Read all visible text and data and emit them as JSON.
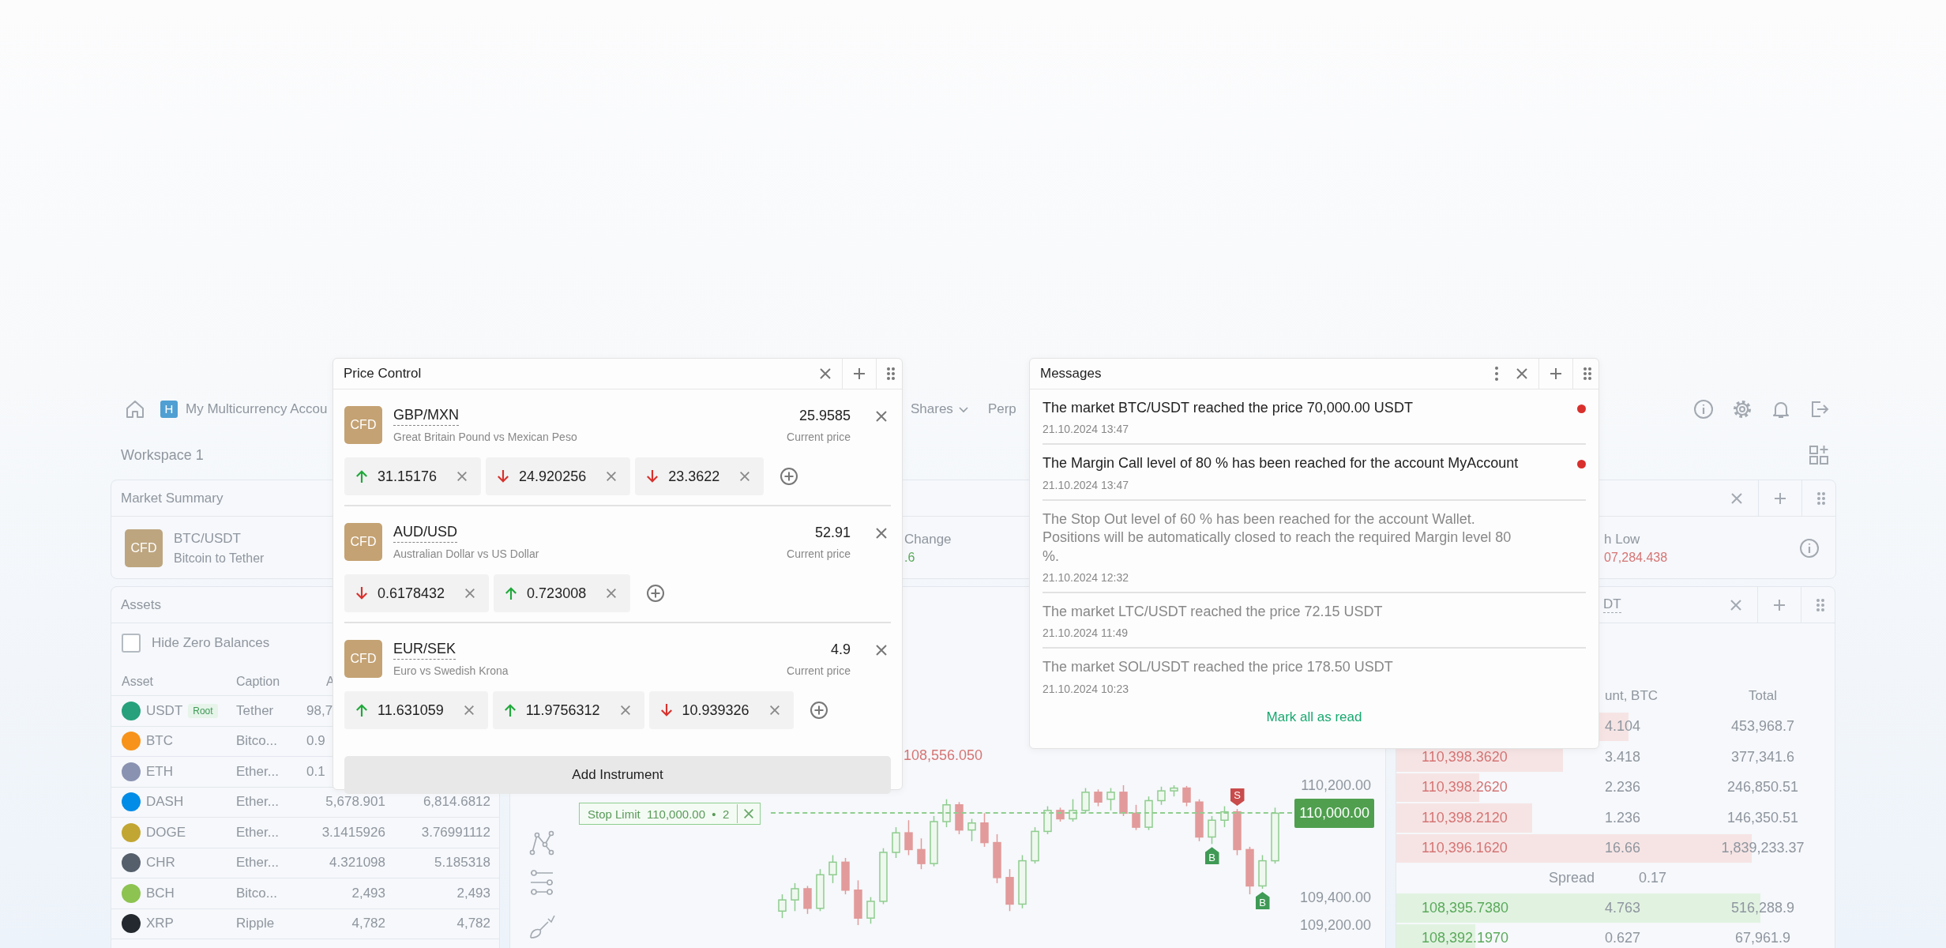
{
  "top_bar": {
    "account_badge": "H",
    "account_name": "My Multicurrency Accou",
    "nav": [
      {
        "label": "Shares",
        "dropdown": true
      },
      {
        "label": "Perp",
        "dropdown": false
      }
    ]
  },
  "workspace": {
    "title": "Workspace 1"
  },
  "market_summary": {
    "title": "Market Summary",
    "badge": "CFD",
    "symbol": "BTC/USDT",
    "description": "Bitcoin to Tether",
    "stats": [
      {
        "label": "Change",
        "value": ".6",
        "kind": "gain"
      },
      {
        "label": "h Low",
        "value": "07,284.438",
        "kind": "loss"
      }
    ]
  },
  "assets": {
    "title": "Assets",
    "hide_zero": {
      "label": "Hide Zero Balances",
      "checked": false
    },
    "columns": [
      "Asset",
      "Caption",
      "A"
    ],
    "rows": [
      {
        "asset": "USDT",
        "tag": "Root",
        "caption": "Tether",
        "column_3": "98,7",
        "color": "#26a17b"
      },
      {
        "asset": "BTC",
        "caption": "Bitco...",
        "column_3": "0.9",
        "color": "#f7931a"
      },
      {
        "asset": "ETH",
        "caption": "Ether...",
        "column_3": "0.1",
        "color": "#8a92b2"
      },
      {
        "asset": "DASH",
        "caption": "Ether...",
        "column_3": "5,678.901",
        "column_4": "6,814.6812",
        "color": "#008ce7"
      },
      {
        "asset": "DOGE",
        "caption": "Ether...",
        "column_3": "3.1415926",
        "column_4": "3.76991112",
        "color": "#c2a633"
      },
      {
        "asset": "CHR",
        "caption": "Ether...",
        "column_3": "4.321098",
        "column_4": "5.185318",
        "color": "#555f6b"
      },
      {
        "asset": "BCH",
        "caption": "Bitco...",
        "column_3": "2,493",
        "column_4": "2,493",
        "color": "#8dc351"
      },
      {
        "asset": "XRP",
        "caption": "Ripple",
        "column_3": "4,782",
        "column_4": "4,782",
        "color": "#23292f"
      }
    ]
  },
  "chart": {
    "last_price": "108,556.050",
    "current_price": "110,000.00",
    "order": {
      "label": "Stop Limit",
      "price": "110,000.00",
      "separator": "•",
      "quantity": "2"
    },
    "markers": [
      {
        "kind": "buy",
        "label": "B"
      },
      {
        "kind": "sell",
        "label": "S"
      },
      {
        "kind": "buy",
        "label": "B"
      }
    ],
    "chart_data": {
      "type": "candlestick",
      "ylim": [
        109200,
        110200
      ],
      "ohlc": [
        [
          109300,
          109420,
          109250,
          109380
        ],
        [
          109380,
          109500,
          109300,
          109460
        ],
        [
          109460,
          109480,
          109280,
          109320
        ],
        [
          109320,
          109600,
          109300,
          109560
        ],
        [
          109560,
          109700,
          109500,
          109650
        ],
        [
          109650,
          109680,
          109420,
          109450
        ],
        [
          109450,
          109520,
          109200,
          109250
        ],
        [
          109250,
          109400,
          109210,
          109370
        ],
        [
          109370,
          109750,
          109350,
          109720
        ],
        [
          109720,
          109900,
          109680,
          109860
        ],
        [
          109860,
          109950,
          109700,
          109740
        ],
        [
          109740,
          109820,
          109600,
          109640
        ],
        [
          109640,
          109980,
          109620,
          109940
        ],
        [
          109940,
          110100,
          109900,
          110060
        ],
        [
          110060,
          110080,
          109850,
          109880
        ],
        [
          109880,
          109960,
          109800,
          109930
        ],
        [
          109930,
          110000,
          109760,
          109790
        ],
        [
          109790,
          109850,
          109500,
          109540
        ],
        [
          109540,
          109600,
          109300,
          109350
        ],
        [
          109350,
          109700,
          109320,
          109660
        ],
        [
          109660,
          109900,
          109640,
          109870
        ],
        [
          109870,
          110050,
          109850,
          110020
        ],
        [
          110020,
          110040,
          109940,
          109960
        ],
        [
          109960,
          110100,
          109940,
          110020
        ],
        [
          110020,
          110180,
          110000,
          110150
        ],
        [
          110150,
          110170,
          110050,
          110080
        ],
        [
          110100,
          110180,
          110020,
          110150
        ],
        [
          110150,
          110200,
          109980,
          110000
        ],
        [
          110000,
          110060,
          109880,
          109900
        ],
        [
          109900,
          110120,
          109880,
          110090
        ],
        [
          110090,
          110190,
          110060,
          110160
        ],
        [
          110160,
          110200,
          110120,
          110180
        ],
        [
          110180,
          110195,
          110050,
          110080
        ],
        [
          110080,
          110100,
          109800,
          109830
        ],
        [
          109830,
          109980,
          109780,
          109950
        ],
        [
          109950,
          110050,
          109900,
          110010
        ],
        [
          110010,
          110030,
          109700,
          109740
        ],
        [
          109740,
          109760,
          109420,
          109480
        ],
        [
          109480,
          109700,
          109460,
          109660
        ],
        [
          109660,
          110040,
          109640,
          110000
        ]
      ],
      "yticks": [
        {
          "value": 110200,
          "label": "110,200.00"
        },
        {
          "value": 109400,
          "label": "109,400.00"
        },
        {
          "value": 109200,
          "label": "109,200.00"
        }
      ]
    }
  },
  "order_book": {
    "title": "DT",
    "columns": [
      "unt, BTC",
      "Total"
    ],
    "asks": [
      {
        "amount": "4.104",
        "total": "453,968.7",
        "level": 0.53
      },
      {
        "price": "110,398.3620",
        "amount": "3.418",
        "total": "377,341.6",
        "level": 0.38
      },
      {
        "price": "110,398.2620",
        "amount": "2.236",
        "total": "246,850.51",
        "level": 0.19
      },
      {
        "price": "110,398.2120",
        "amount": "1.236",
        "total": "146,350.51",
        "level": 0.31
      },
      {
        "price": "110,396.1620",
        "amount": "16.66",
        "total": "1,839,233.37",
        "level": 0.81
      }
    ],
    "spread": {
      "label": "Spread",
      "value": "0.17"
    },
    "bids": [
      {
        "price": "108,395.7380",
        "amount": "4.763",
        "total": "516,288.9",
        "level": 0.83
      },
      {
        "price": "108,392.1970",
        "amount": "0.627",
        "total": "67,961.9",
        "level": 0.18
      }
    ]
  },
  "price_control": {
    "title": "Price Control",
    "instruments": [
      {
        "badge": "CFD",
        "symbol": "GBP/MXN",
        "description": "Great Britain Pound vs Mexican Peso",
        "price": "25.9585",
        "price_label": "Current price",
        "alerts": [
          {
            "kind": "up",
            "value": "31.15176"
          },
          {
            "kind": "down",
            "value": "24.920256"
          },
          {
            "kind": "down",
            "value": "23.3622"
          }
        ]
      },
      {
        "badge": "CFD",
        "symbol": "AUD/USD",
        "description": "Australian Dollar vs US Dollar",
        "price": "52.91",
        "price_label": "Current price",
        "alerts": [
          {
            "kind": "down",
            "value": "0.6178432"
          },
          {
            "kind": "up",
            "value": "0.723008"
          }
        ]
      },
      {
        "badge": "CFD",
        "symbol": "EUR/SEK",
        "description": "Euro vs Swedish Krona",
        "price": "4.9",
        "price_label": "Current price",
        "alerts": [
          {
            "kind": "up",
            "value": "11.631059"
          },
          {
            "kind": "up",
            "value": "11.9756312"
          },
          {
            "kind": "down",
            "value": "10.939326"
          }
        ]
      }
    ],
    "add_button": "Add Instrument"
  },
  "messages": {
    "title": "Messages",
    "items": [
      {
        "text": "The market BTC/USDT reached the price 70,000.00 USDT",
        "date": "21.10.2024 13:47",
        "unread": true
      },
      {
        "text": "The Margin Call level of 80 % has been reached for the account MyAccount",
        "date": "21.10.2024 13:47",
        "unread": true
      },
      {
        "text": "The Stop Out level of 60 % has been reached for the account Wallet.\nPositions will be automatically closed to reach the required Margin level 80 %.",
        "date": "21.10.2024 12:32",
        "unread": false
      },
      {
        "text": "The market LTC/USDT reached the price 72.15 USDT",
        "date": "21.10.2024 11:49",
        "unread": false
      },
      {
        "text": "The market SOL/USDT reached the price 178.50 USDT",
        "date": "21.10.2024 10:23",
        "unread": false
      }
    ],
    "mark_all": "Mark all as read"
  }
}
